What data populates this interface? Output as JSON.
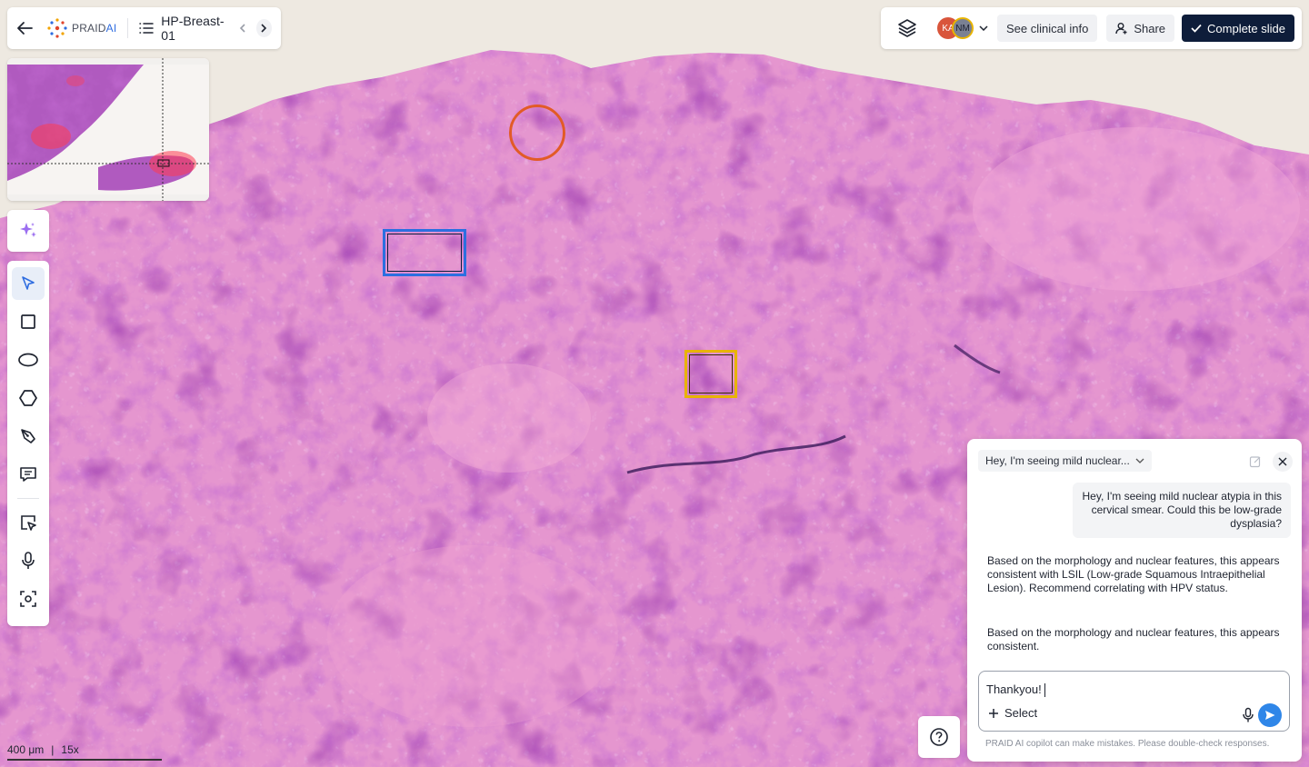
{
  "header": {
    "brand": "PRAID",
    "brand_ai": "AI",
    "slide_name": "HP-Breast-01"
  },
  "topbar": {
    "avatars": [
      {
        "initials": "KA",
        "color": "#d9553b"
      },
      {
        "initials": "NM",
        "color": "#7a8193"
      }
    ],
    "clinical_info_label": "See clinical info",
    "share_label": "Share",
    "complete_label": "Complete slide"
  },
  "tools": [
    "ai-assist",
    "select",
    "rectangle",
    "ellipse",
    "polygon",
    "pen",
    "comment",
    "screen-select",
    "voice",
    "capture"
  ],
  "chat": {
    "thread_title": "Hey, I'm seeing mild nuclear...",
    "user_message": "Hey, I'm seeing mild nuclear atypia in this cervical smear. Could this be low-grade dysplasia?",
    "ai_message_1": "Based on the morphology and nuclear features, this appears consistent with LSIL (Low-grade Squamous Intraepithelial Lesion). Recommend correlating with HPV status.",
    "ai_message_2": "Based on the morphology and nuclear features, this appears consistent.",
    "input_value": "Thankyou!",
    "select_label": "Select",
    "disclaimer": "PRAID AI copilot can make mistakes. Please double-check responses."
  },
  "scale": {
    "length": "400  μm",
    "zoom": "15x"
  },
  "colors": {
    "primary_dark": "#0e1d3a",
    "send_blue": "#2f86e8",
    "annotation_circle": "#e25b26",
    "annotation_blue": "#2c6fe0",
    "annotation_yellow": "#e8b400"
  }
}
